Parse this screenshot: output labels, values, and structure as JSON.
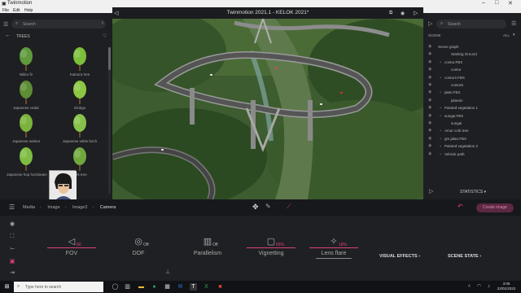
{
  "window": {
    "title": "Twinmotion 2021.1 - KELOK 2021*",
    "app_name": "Twinmotion"
  },
  "menu": [
    "File",
    "Edit",
    "Help"
  ],
  "left_panel": {
    "search_placeholder": "Search",
    "category": "TREES",
    "trees": [
      {
        "label": "Nikko fir",
        "color": "#5f9a3c"
      },
      {
        "label": "Katsura tree",
        "color": "#7bbf3a"
      },
      {
        "label": "Japanese cedar",
        "color": "#5d8d34"
      },
      {
        "label": "Ginkgo",
        "color": "#8cc743"
      },
      {
        "label": "Japanese walnut",
        "color": "#7bb33b"
      },
      {
        "label": "Japanese white birch",
        "color": "#86c14a"
      },
      {
        "label": "Japanese hop hornbeam",
        "color": "#7fbd42"
      },
      {
        "label": "cork tree",
        "color": "#6fa83d"
      }
    ]
  },
  "right_panel": {
    "search_placeholder": "Search",
    "header": "SCENE",
    "filter": "ALL",
    "nodes": [
      {
        "name": "Scene graph",
        "indent": 0
      },
      {
        "name": "Starting Ground",
        "indent": 2
      },
      {
        "name": "contur.FBX",
        "indent": 1
      },
      {
        "name": "contur",
        "indent": 2
      },
      {
        "name": "contur2.FBX",
        "indent": 1
      },
      {
        "name": "contur6",
        "indent": 2
      },
      {
        "name": "jalan.FBX",
        "indent": 1
      },
      {
        "name": "jalanan",
        "indent": 2
      },
      {
        "name": "Painted vegetation 1",
        "indent": 1
      },
      {
        "name": "sungai.FBX",
        "indent": 1
      },
      {
        "name": "sungai",
        "indent": 2
      },
      {
        "name": "Amur cork tree",
        "indent": 1
      },
      {
        "name": "grs jalan.FBX",
        "indent": 1
      },
      {
        "name": "Painted vegetation 2",
        "indent": 1
      },
      {
        "name": "Vehicle path",
        "indent": 1
      }
    ],
    "statistics_label": "STATISTICS"
  },
  "breadcrumb": [
    "Media",
    "Image",
    "Image2",
    "Camera"
  ],
  "render_button": "Create image",
  "camera_controls": [
    {
      "name": "FOV",
      "value": "60",
      "active": true,
      "icon": "fov-icon"
    },
    {
      "name": "DOF",
      "value": "Off",
      "active": false,
      "icon": "aperture-icon"
    },
    {
      "name": "Parallelism",
      "value": "Off",
      "active": false,
      "icon": "grid-icon"
    },
    {
      "name": "Vignetting",
      "value": "65%",
      "active": true,
      "icon": "vignette-icon"
    },
    {
      "name": "Lens flare",
      "value": "18%",
      "active": true,
      "icon": "sparkle-icon"
    }
  ],
  "visual_effects_label": "VISUAL EFFECTS",
  "scene_state_label": "SCENE STATE",
  "taskbar": {
    "search_placeholder": "Type here to search",
    "time": "3:06",
    "date": "22/01/2022"
  },
  "colors": {
    "accent": "#e0407a",
    "background": "#1b1c1f",
    "panel": "#1e1f22"
  }
}
